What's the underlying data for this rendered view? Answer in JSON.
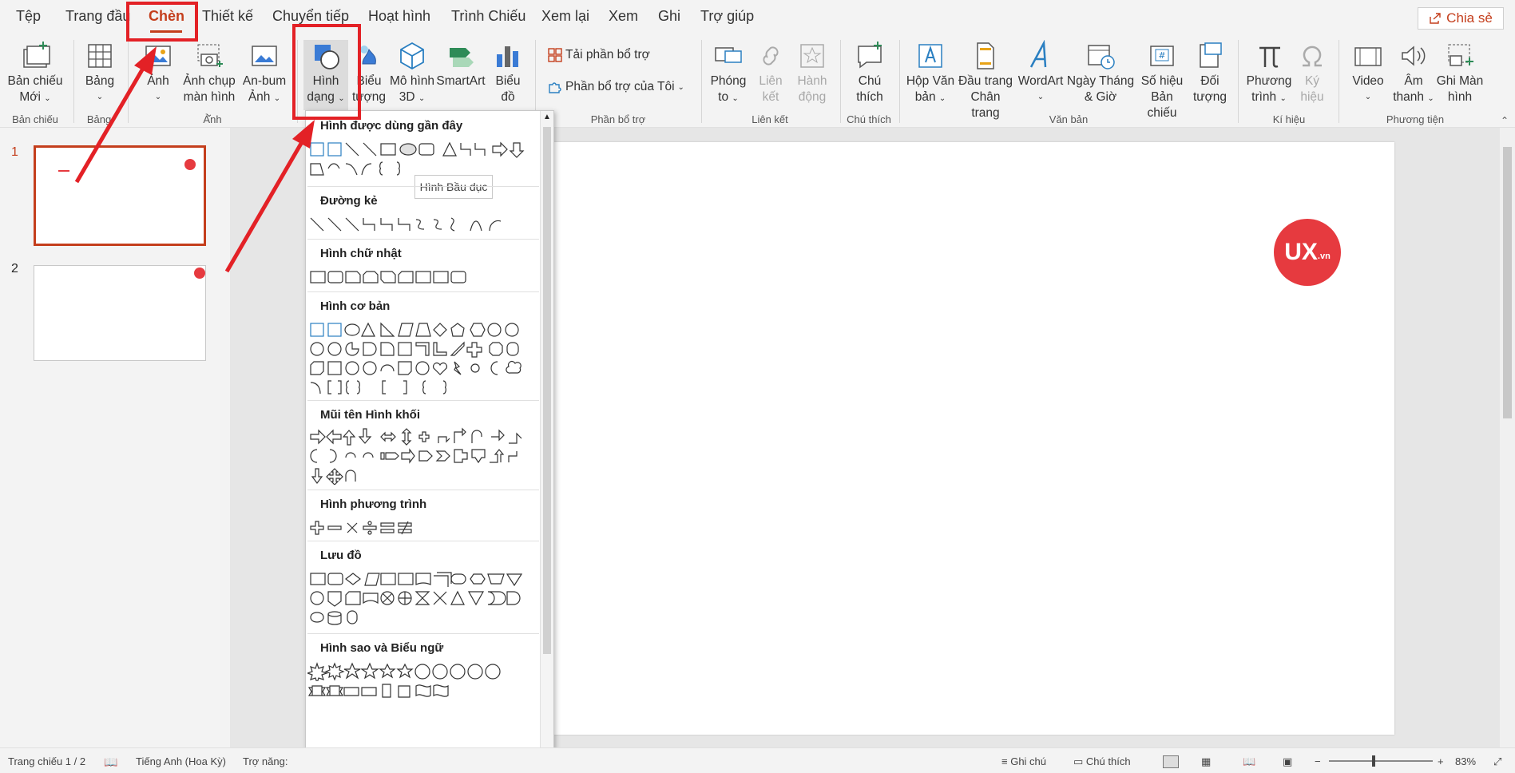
{
  "tabs": [
    "Tệp",
    "Trang đầu",
    "Chèn",
    "Thiết kế",
    "Chuyển tiếp",
    "Hoạt hình",
    "Trình Chiếu",
    "Xem lại",
    "Xem",
    "Ghi",
    "Trợ giúp"
  ],
  "share": {
    "label": "Chia sẻ",
    "icon": "share-icon"
  },
  "ribbon": {
    "new_slide": [
      "Bản chiếu",
      "Mới"
    ],
    "table": [
      "Bảng",
      ""
    ],
    "pictures": [
      "Ảnh",
      ""
    ],
    "screenshot": [
      "Ảnh chụp",
      "màn hình"
    ],
    "album": [
      "An-bum",
      "Ảnh"
    ],
    "shapes": [
      "Hình",
      "dạng"
    ],
    "icons": [
      "Biểu",
      "tượng"
    ],
    "models3d": [
      "Mô hình",
      "3D"
    ],
    "smartart": [
      "SmartArt",
      ""
    ],
    "chart": [
      "Biểu",
      "đồ"
    ],
    "addins_get": "Tải phần bổ trợ",
    "addins_my": "Phần bổ trợ của Tôi",
    "zoom": [
      "Phóng",
      "to"
    ],
    "link": [
      "Liên",
      "kết"
    ],
    "action": [
      "Hành",
      "động"
    ],
    "comment": [
      "Chú",
      "thích"
    ],
    "textbox": [
      "Hộp Văn",
      "bản"
    ],
    "header": [
      "Đầu trang",
      "Chân trang"
    ],
    "wordart": [
      "WordArt",
      ""
    ],
    "datetime": [
      "Ngày Tháng",
      "& Giờ"
    ],
    "slidenum": [
      "Số hiệu",
      "Bản chiếu"
    ],
    "object": [
      "Đối",
      "tượng"
    ],
    "equation": [
      "Phương",
      "trình"
    ],
    "symbol": [
      "Ký",
      "hiệu"
    ],
    "video": [
      "Video",
      ""
    ],
    "audio": [
      "Âm",
      "thanh"
    ],
    "screenrec": [
      "Ghi Màn",
      "hình"
    ]
  },
  "groups": [
    "Bản chiếu",
    "Bảng",
    "Ảnh",
    "Phần bổ trợ",
    "Liên kết",
    "Chú thích",
    "Văn bản",
    "Kí hiệu",
    "Phương tiện"
  ],
  "thumbnails": [
    {
      "num": "1"
    },
    {
      "num": "2"
    }
  ],
  "slide": {
    "logo_text": "UX",
    "logo_sub": ".vn"
  },
  "shapes_gallery": {
    "sections": [
      "Hình được dùng gần đây",
      "Đường kẻ",
      "Hình chữ nhật",
      "Hình cơ bản",
      "Mũi tên Hình khối",
      "Hình phương trình",
      "Lưu đồ",
      "Hình sao và Biểu ngữ"
    ],
    "tooltip": "Hình Bầu dục"
  },
  "statusbar": {
    "slide": "Trang chiếu 1 / 2",
    "language": "Tiếng Anh (Hoa Kỳ)",
    "accessibility": "Trợ năng:",
    "notes": "Ghi chú",
    "comments": "Chú thích",
    "zoom": "83%"
  },
  "colors": {
    "accent": "#c43e1c",
    "highlight": "#e32126",
    "logo": "#e63a3f"
  }
}
